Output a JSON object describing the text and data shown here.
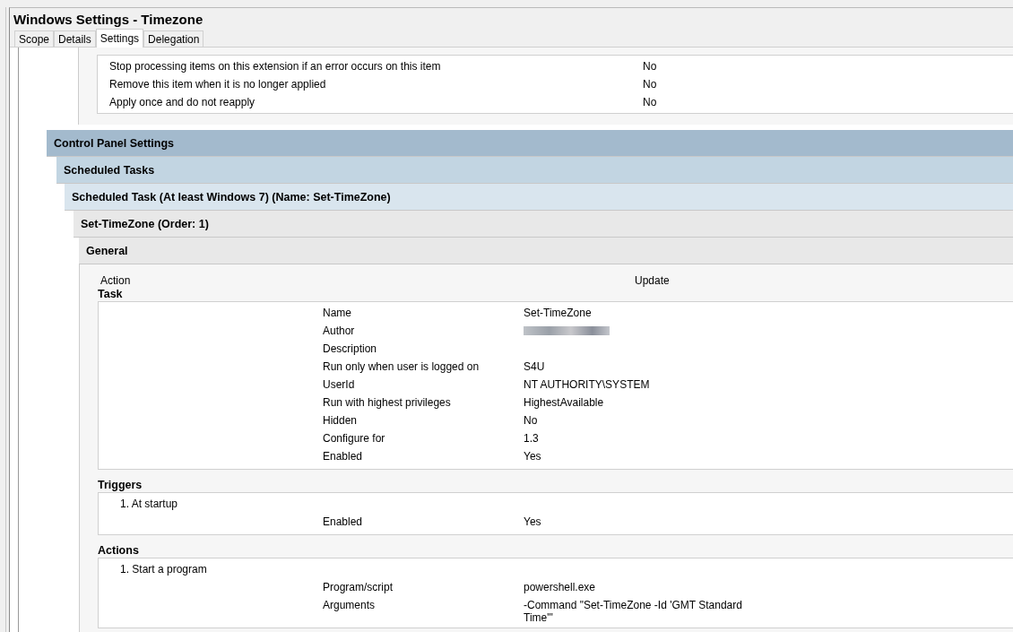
{
  "window": {
    "title": "Windows Settings - Timezone"
  },
  "tabs": [
    {
      "label": "Scope",
      "selected": false
    },
    {
      "label": "Details",
      "selected": false
    },
    {
      "label": "Settings",
      "selected": true
    },
    {
      "label": "Delegation",
      "selected": false
    }
  ],
  "options": {
    "rows": [
      {
        "label": "Stop processing items on this extension if an error occurs on this item",
        "value": "No"
      },
      {
        "label": "Remove this item when it is no longer applied",
        "value": "No"
      },
      {
        "label": "Apply once and do not reapply",
        "value": "No"
      }
    ]
  },
  "sections": [
    {
      "title": "Control Panel Settings",
      "children": [
        {
          "title": "Scheduled Tasks",
          "children": [
            {
              "title": "Scheduled Task (At least Windows 7) (Name: Set-TimeZone)",
              "children": [
                {
                  "title": "Set-TimeZone (Order: 1)",
                  "children": [
                    {
                      "title": "General"
                    }
                  ]
                }
              ]
            }
          ]
        }
      ]
    }
  ],
  "general": {
    "action": {
      "label": "Action",
      "value": "Update"
    },
    "groups": [
      {
        "title": "Task",
        "items": [
          {
            "rows": [
              {
                "label": "Name",
                "value": "Set-TimeZone",
                "kind": "text"
              },
              {
                "label": "Author",
                "kind": "redacted"
              },
              {
                "label": "Description",
                "kind": "text"
              },
              {
                "label": "Run only when user is logged on",
                "value": "S4U",
                "kind": "text"
              },
              {
                "label": "UserId",
                "value": "NT AUTHORITY\\SYSTEM",
                "kind": "text"
              },
              {
                "label": "Run with highest privileges",
                "value": "HighestAvailable",
                "kind": "text"
              },
              {
                "label": "Hidden",
                "value": "No",
                "kind": "text"
              },
              {
                "label": "Configure for",
                "value": "1.3",
                "kind": "text"
              },
              {
                "label": "Enabled",
                "value": "Yes",
                "kind": "text"
              }
            ]
          }
        ]
      },
      {
        "title": "Triggers",
        "items": [
          {
            "title": "1. At startup",
            "rows": [
              {
                "label": "Enabled",
                "value": "Yes",
                "kind": "text"
              }
            ]
          }
        ]
      },
      {
        "title": "Actions",
        "items": [
          {
            "title": "1. Start a program",
            "rows": [
              {
                "label": "Program/script",
                "value": "powershell.exe",
                "kind": "text"
              },
              {
                "label": "Arguments",
                "value": "-Command \"Set-TimeZone -Id 'GMT Standard Time'\"",
                "kind": "text"
              }
            ]
          }
        ]
      }
    ]
  }
}
